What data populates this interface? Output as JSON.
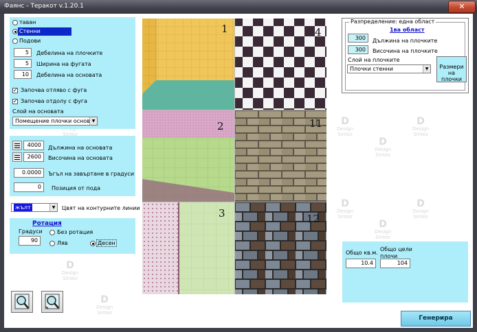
{
  "window": {
    "title": "Фаянс - Теракот v.1.20.1",
    "close_glyph": "✕"
  },
  "watermark": {
    "logo": "D",
    "line1": "Design",
    "line2": "Sintez"
  },
  "left_panel": {
    "surfaces": [
      {
        "label": "таван",
        "selected": false
      },
      {
        "label": "Стенни",
        "selected": true
      },
      {
        "label": "Подови",
        "selected": false
      }
    ],
    "params": [
      {
        "value": "5",
        "label": "Дебелина на плочките"
      },
      {
        "value": "5",
        "label": "Ширина на фугата"
      },
      {
        "value": "10",
        "label": "Дебелина  на основата"
      }
    ],
    "checks": [
      {
        "label": "Започва отляво с фуга",
        "checked": true
      },
      {
        "label": "Започва отдолу с фуга",
        "checked": true
      }
    ],
    "base_layer_label": "Слой на основата",
    "base_layer_value": "Помещение плочки основа",
    "length": {
      "value": "4000",
      "label": "Дължина на основата"
    },
    "height": {
      "value": "2600",
      "label": "Височина на основата"
    },
    "angle": {
      "value": "0.0000",
      "label": "Ъгъл на завъртане в градуси"
    },
    "position": {
      "value": "0",
      "label": "Позиция от пода"
    },
    "color": {
      "value": "жълт",
      "label": "Цвят на контурните линии"
    }
  },
  "rotation": {
    "title": "Ротация",
    "degrees_label": "Градуси",
    "degrees_value": "90",
    "options": [
      {
        "label": "Без ротация",
        "selected": false
      },
      {
        "label": "Ляв",
        "selected": false
      },
      {
        "label": "Десен",
        "selected": true
      }
    ]
  },
  "tiles": [
    "1",
    "4",
    "2",
    "11",
    "3",
    "12"
  ],
  "right_panel": {
    "group_title": "Разпределение: една област",
    "area_title": "1ва област",
    "tile_length": {
      "value": "300",
      "label": "Дължина на плочките"
    },
    "tile_height": {
      "value": "300",
      "label": "Височина на плочките"
    },
    "tile_layer_label": "Слой на плочките",
    "tile_layer_value": "Плочки стенни",
    "sizes_button": "Размери на плочки"
  },
  "totals": {
    "area_label": "Общо кв.м.",
    "area_value": "10.4",
    "count_label": "Общо цели плочи",
    "count_value": "104"
  },
  "generate_button": "Генерира",
  "icons": [
    "zoom-in-icon",
    "zoom-out-icon"
  ]
}
